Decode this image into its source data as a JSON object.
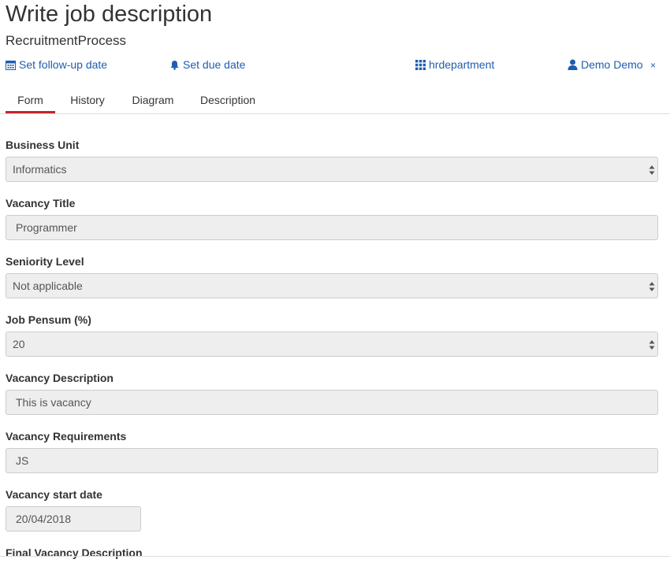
{
  "header": {
    "title": "Write job description",
    "process": "RecruitmentProcess"
  },
  "actions": {
    "follow_up": "Set follow-up date",
    "due_date": "Set due date",
    "group": "hrdepartment",
    "user": "Demo Demo",
    "close": "×"
  },
  "tabs": [
    {
      "label": "Form",
      "active": true
    },
    {
      "label": "History",
      "active": false
    },
    {
      "label": "Diagram",
      "active": false
    },
    {
      "label": "Description",
      "active": false
    }
  ],
  "form": {
    "business_unit": {
      "label": "Business Unit",
      "value": "Informatics"
    },
    "vacancy_title": {
      "label": "Vacancy Title",
      "value": "Programmer"
    },
    "seniority_level": {
      "label": "Seniority Level",
      "value": "Not applicable"
    },
    "job_pensum": {
      "label": "Job Pensum (%)",
      "value": "20"
    },
    "vacancy_description": {
      "label": "Vacancy Description",
      "value": "This is vacancy"
    },
    "vacancy_requirements": {
      "label": "Vacancy Requirements",
      "value": "JS"
    },
    "vacancy_start_date": {
      "label": "Vacancy start date",
      "value": "20/04/2018"
    },
    "final_vacancy_description": {
      "label": "Final Vacancy Description"
    }
  },
  "colors": {
    "link": "#1e5eb0",
    "active_tab_underline": "#c0262a",
    "field_background": "#eeeeee"
  },
  "icons": {
    "follow_up": "calendar-icon",
    "due_date": "bell-icon",
    "group": "grid-icon",
    "user": "user-icon",
    "select_arrows": "up-down-arrows-icon"
  }
}
